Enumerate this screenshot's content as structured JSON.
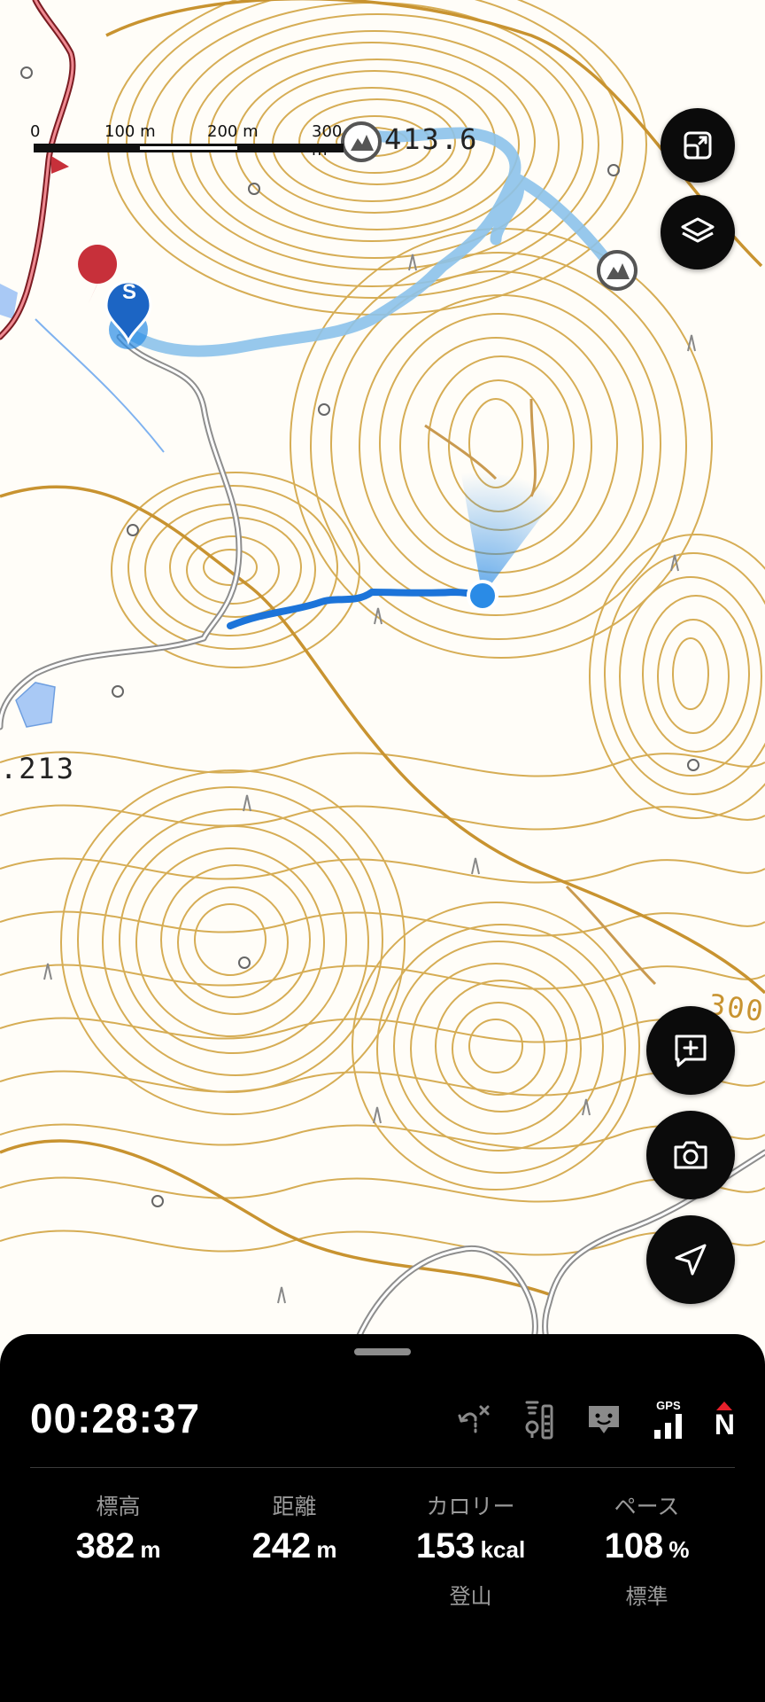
{
  "map": {
    "scale_labels": [
      "0",
      "100 m",
      "200 m",
      "300 m"
    ],
    "elevation_labels": [
      "413.6",
      ".213",
      "300"
    ],
    "start_marker": "S",
    "colors": {
      "contour": "#d6ad55",
      "contour_index": "#c89330",
      "track_done": "#1c74d9",
      "planned_route": "#8cc2ea",
      "road": "#9a9a9a",
      "prefecture_road": "#c7303a",
      "water": "#a9c9f5",
      "current_position": "#2a8be6"
    }
  },
  "fabs": {
    "expand": "expand-icon",
    "layers": "layers-icon",
    "add_memo": "add-memo-icon",
    "camera": "camera-icon",
    "navigate": "navigation-arrow-icon"
  },
  "panel": {
    "elapsed_time": "00:28:37",
    "status_icons": [
      "route-off-icon",
      "signal-level-icon",
      "chat-icon",
      "gps-signal-icon",
      "compass-north-icon"
    ],
    "gps_label": "GPS",
    "compass_label": "N",
    "stats": [
      {
        "label": "標高",
        "value": "382",
        "unit": "m",
        "sub": ""
      },
      {
        "label": "距離",
        "value": "242",
        "unit": "m",
        "sub": ""
      },
      {
        "label": "カロリー",
        "value": "153",
        "unit": "kcal",
        "sub": "登山"
      },
      {
        "label": "ペース",
        "value": "108",
        "unit": "%",
        "sub": "標準"
      }
    ]
  }
}
